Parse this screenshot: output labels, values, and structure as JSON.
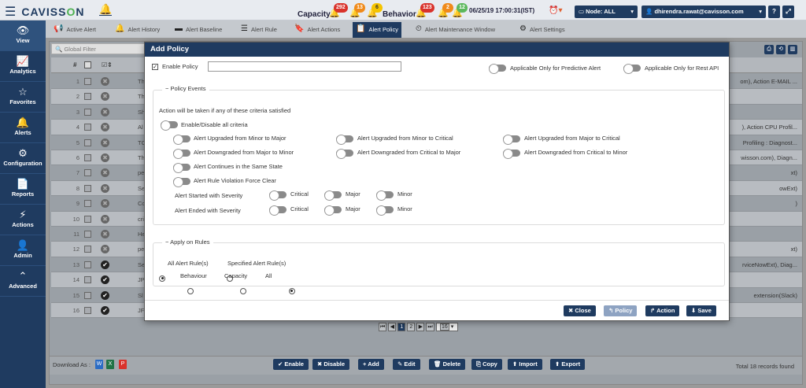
{
  "header": {
    "brand_prefix": "CAVISS",
    "brand_o": "O",
    "brand_suffix": "N",
    "capacity_label": "Capacity",
    "capacity_badges": [
      "292",
      "13",
      "6"
    ],
    "behavior_label": "Behavior",
    "behavior_badges": [
      "123",
      "2",
      "12"
    ],
    "datetime": "06/25/19 17:00:31(IST)",
    "node": "Node: ALL",
    "user": "dhirendra.rawat@cavisson.com",
    "help": "?",
    "expand": "⤢",
    "colors": {
      "brand": "#1f3b60",
      "accent_green": "#4cb050",
      "critical": "#d9322b",
      "major": "#f08a1a",
      "minor": "#f5c400"
    }
  },
  "leftnav": [
    {
      "label": "View",
      "icon": "eye-icon",
      "glyph": "👁"
    },
    {
      "label": "Analytics",
      "icon": "chart-icon",
      "glyph": "📈"
    },
    {
      "label": "Favorites",
      "icon": "star-icon",
      "glyph": "☆"
    },
    {
      "label": "Alerts",
      "icon": "bell-icon",
      "glyph": "🔔"
    },
    {
      "label": "Configuration",
      "icon": "gears-icon",
      "glyph": "⚙"
    },
    {
      "label": "Reports",
      "icon": "report-icon",
      "glyph": "📄"
    },
    {
      "label": "Actions",
      "icon": "actions-icon",
      "glyph": "⚡"
    },
    {
      "label": "Admin",
      "icon": "user-icon",
      "glyph": "👤"
    },
    {
      "label": "Advanced",
      "icon": "chevron-up-icon",
      "glyph": "⌃"
    }
  ],
  "tabs": [
    {
      "label": "Active Alert",
      "icon": "megaphone-icon",
      "glyph": "📢"
    },
    {
      "label": "Alert History",
      "icon": "bell-icon",
      "glyph": "🔔"
    },
    {
      "label": "Alert Baseline",
      "icon": "baseline-icon",
      "glyph": "▬"
    },
    {
      "label": "Alert Rule",
      "icon": "rule-icon",
      "glyph": "☰"
    },
    {
      "label": "Alert Actions",
      "icon": "bookmark-icon",
      "glyph": "🔖"
    },
    {
      "label": "Alert Policy",
      "icon": "policy-icon",
      "glyph": "📋"
    },
    {
      "label": "Alert Maintenance Window",
      "icon": "clock-icon",
      "glyph": "⏲"
    },
    {
      "label": "Alert Settings",
      "icon": "gear-icon",
      "glyph": "⚙"
    }
  ],
  "grid": {
    "filter_placeholder": "Global Filter",
    "hash": "#",
    "rows": [
      {
        "n": "1",
        "c": "Th",
        "r": "om), Action E-MAIL ..."
      },
      {
        "n": "2",
        "c": "Th",
        "r": ""
      },
      {
        "n": "3",
        "c": "Sh",
        "r": ""
      },
      {
        "n": "4",
        "c": "Al",
        "r": "), Action CPU Profil..."
      },
      {
        "n": "5",
        "c": "TC",
        "r": "Profiling : Diagnost..."
      },
      {
        "n": "6",
        "c": "Th",
        "r": "wisson.com), Diagn..."
      },
      {
        "n": "7",
        "c": "pe",
        "r": "xt)"
      },
      {
        "n": "8",
        "c": "Se",
        "r": "owExt)"
      },
      {
        "n": "9",
        "c": "Cc",
        "r": ")"
      },
      {
        "n": "10",
        "c": "cri",
        "r": ""
      },
      {
        "n": "11",
        "c": "He",
        "r": ""
      },
      {
        "n": "12",
        "c": "pe",
        "r": "xt)"
      },
      {
        "n": "13",
        "c": "Se",
        "r": "rviceNowExt), Diag..."
      },
      {
        "n": "14",
        "c": "JP",
        "r": ""
      },
      {
        "n": "15",
        "c": "Sl",
        "r": "extension(Slack)"
      },
      {
        "n": "16",
        "c": "JF",
        "r": ""
      }
    ],
    "pager": {
      "pages": [
        "1",
        "2"
      ],
      "page_size": "16"
    }
  },
  "footer": {
    "download_as": "Download As :",
    "buttons": [
      "Enable",
      "Disable",
      "Add",
      "Edit",
      "Delete",
      "Copy",
      "Import",
      "Export"
    ],
    "total": "Total 18 records found"
  },
  "modal": {
    "title": "Add Policy",
    "enable_policy": "Enable Policy",
    "policy_name_value": "",
    "predictive_only": "Applicable Only for Predictive Alert",
    "rest_api_only": "Applicable Only for Rest API",
    "policy_events_legend": "Policy Events",
    "criteria_note": "Action will be taken if any of these criteria satisfied",
    "enable_all": "Enable/Disable all criteria",
    "events": [
      "Alert Upgraded from Minor to Major",
      "Alert Upgraded from Minor to Critical",
      "Alert Upgraded from Major to Critical",
      "Alert Downgraded from Major to Minor",
      "Alert Downgraded from Critical to Major",
      "Alert Downgraded from Critical to Minor",
      "Alert Continues in the Same State",
      "Alert Rule Violation Force Clear"
    ],
    "started_with": "Alert Started with Severity",
    "ended_with": "Alert Ended with Severity",
    "severities": [
      "Critical",
      "Major",
      "Minor"
    ],
    "apply_legend": "Apply on Rules",
    "all_rules": "All Alert Rule(s)",
    "specified_rules": "Specified Alert Rule(s)",
    "type_options": [
      "Behaviour",
      "Capacity",
      "All"
    ],
    "buttons": {
      "close": "Close",
      "policy": "Policy",
      "action": "Action",
      "save": "Save"
    }
  }
}
